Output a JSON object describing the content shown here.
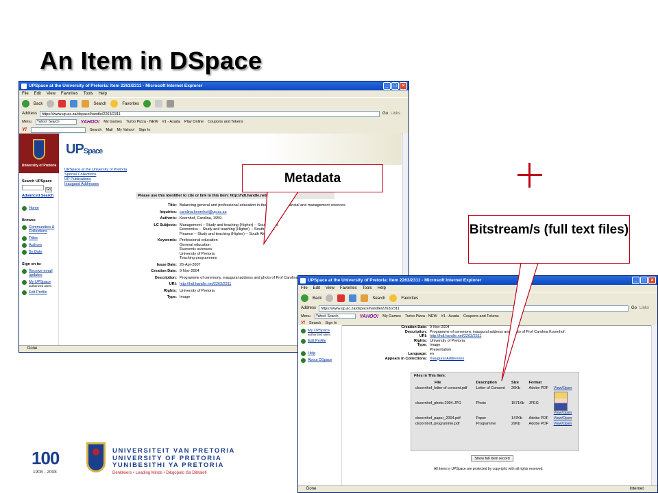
{
  "slide": {
    "title": "An Item in DSpace"
  },
  "callouts": {
    "metadata": "Metadata",
    "bitstreams": "Bitstream/s (full text files)"
  },
  "browser1": {
    "title": "UPSpace at the University of Pretoria: Item 2263/2311 - Microsoft Internet Explorer",
    "menu": [
      "File",
      "Edit",
      "View",
      "Favorites",
      "Tools",
      "Help"
    ],
    "toolbar": [
      "Back",
      "Search",
      "Favorites"
    ],
    "address_label": "Address",
    "address": "https://www.up.ac.za/dspace/handle/2263/2311",
    "go": "Go",
    "links": "Links",
    "yahoo_toolbar": [
      "Menu",
      "Yahoo! Search",
      "My Games",
      "Turbo Pizza - NEW",
      "#1 - Azada",
      "Play Online",
      "Coupons and Tokens"
    ],
    "yahoo_toolbar2": [
      "Search",
      "Mail",
      "My Yahoo!",
      "Sign In"
    ],
    "status": "Done",
    "sidebar": {
      "logo_text": "University of Pretoria",
      "search_label": "Search UPSpace",
      "go": "Go",
      "advanced": "Advanced Search",
      "home": "Home",
      "browse": "Browse",
      "links": [
        "Communities & Collections",
        "Titles",
        "Authors",
        "By Date"
      ],
      "sign_on": "Sign on to:",
      "sign_links": [
        "Receive email updates",
        "My UPSpace",
        "Edit Profile"
      ],
      "authorized": "authorized users"
    },
    "banner": {
      "up": "UP",
      "space": "Space"
    },
    "crumbs": [
      "UPSpace at the University of Pretoria",
      "Special Collections",
      "UP Publications",
      "Inaugural Addresses"
    ],
    "identifier": "Please use this identifier to cite or link to this item: http://hdl.handle.net/2263/2311",
    "metadata": [
      {
        "k": "Title:",
        "v": [
          "Balancing general and professional education in the economic, financial and management sciences"
        ]
      },
      {
        "k": "Inquiries:",
        "v": [
          "carolina.koornhof@up.ac.za"
        ],
        "link": true
      },
      {
        "k": "Author/s:",
        "v": [
          "Koornhof, Carolina, 1959-"
        ]
      },
      {
        "k": "LC Subjects:",
        "v": [
          "Management -- Study and teaching (Higher) -- South Africa",
          "Economics -- Study and teaching (Higher) -- South Africa",
          "Finance -- Study and teaching (Higher) -- South Africa"
        ]
      },
      {
        "k": "Keywords:",
        "v": [
          "Professional education",
          "General education",
          "Economic sciences",
          "University of Pretoria",
          "Teaching programmes"
        ]
      },
      {
        "k": "Issue Date:",
        "v": [
          "26-Apr-2007"
        ]
      },
      {
        "k": "Creation Date:",
        "v": [
          "9-Nov-2004"
        ]
      },
      {
        "k": "Description:",
        "v": [
          "Programme of ceremony, inaugural address and photo of Prof Carolina Koornhof."
        ]
      },
      {
        "k": "URI:",
        "v": [
          "http://hdl.handle.net/2263/2311"
        ],
        "link": true
      },
      {
        "k": "Rights:",
        "v": [
          "University of Pretoria"
        ]
      },
      {
        "k": "Type:",
        "v": [
          "Image"
        ]
      }
    ]
  },
  "browser2": {
    "title": "UPSpace at the University of Pretoria: Item 2263/2311 - Microsoft Internet Explorer",
    "menu": [
      "File",
      "Edit",
      "View",
      "Favorites",
      "Tools",
      "Help"
    ],
    "address": "https://www.up.ac.za/dspace/handle/2263/2311",
    "status": "Done",
    "status_right": "Internet",
    "sidebar_links": [
      "My UPSpace",
      "Edit Profile",
      "Help",
      "About DSpace"
    ],
    "authorized": "authorized users",
    "metadata": [
      {
        "k": "Creation Date:",
        "v": "9-Nov-2004"
      },
      {
        "k": "Description:",
        "v": "Programme of ceremony, inaugural address and photo of Prof Carolina Koornhof."
      },
      {
        "k": "URI:",
        "v": "http://hdl.handle.net/2263/2311",
        "link": true
      },
      {
        "k": "Rights:",
        "v": "University of Pretoria"
      },
      {
        "k": "Type:",
        "v": "Image"
      },
      {
        "k": "",
        "v": "Presentation"
      },
      {
        "k": "Language:",
        "v": "en"
      },
      {
        "k": "Appears in Collections:",
        "v": "Inaugural Addresses",
        "link": true
      }
    ],
    "files_heading": "Files in This Item:",
    "files_columns": [
      "File",
      "Description",
      "Size",
      "Format",
      ""
    ],
    "files": [
      {
        "file": "ckoornhof_letter of consent.pdf",
        "desc": "Letter of Consent",
        "size": "26Kb",
        "format": "Adobe PDF",
        "action": "View/Open"
      },
      {
        "file": "ckoornhof_photo.2004.JPG",
        "desc": "Photo",
        "size": "1571Kb",
        "format": "JPEG",
        "action": "View/Open"
      },
      {
        "file": "ckoornhof_paper_2004.pdf",
        "desc": "Paper",
        "size": "147Kb",
        "format": "Adobe PDF",
        "action": "View/Open"
      },
      {
        "file": "ckoornhof_programme.pdf",
        "desc": "Programme",
        "size": "29Kb",
        "format": "Adobe PDF",
        "action": "View/Open"
      }
    ],
    "full_record": "Show full item record",
    "copyright": "All items in UPSpace are protected by copyright, with all rights reserved."
  },
  "footer": {
    "hundred": "100",
    "years": "1908 - 2008",
    "lines": [
      "UNIVERSITEIT VAN PRETORIA",
      "UNIVERSITY OF PRETORIA",
      "YUNIBESITHI YA PRETORIA"
    ],
    "tagline": "Denkleiers • Leading Minds • Dikgopolo tša Dihlalefi"
  },
  "colors": {
    "accent_red": "#c0001a",
    "up_blue": "#1c3f8c",
    "link": "#003399"
  }
}
